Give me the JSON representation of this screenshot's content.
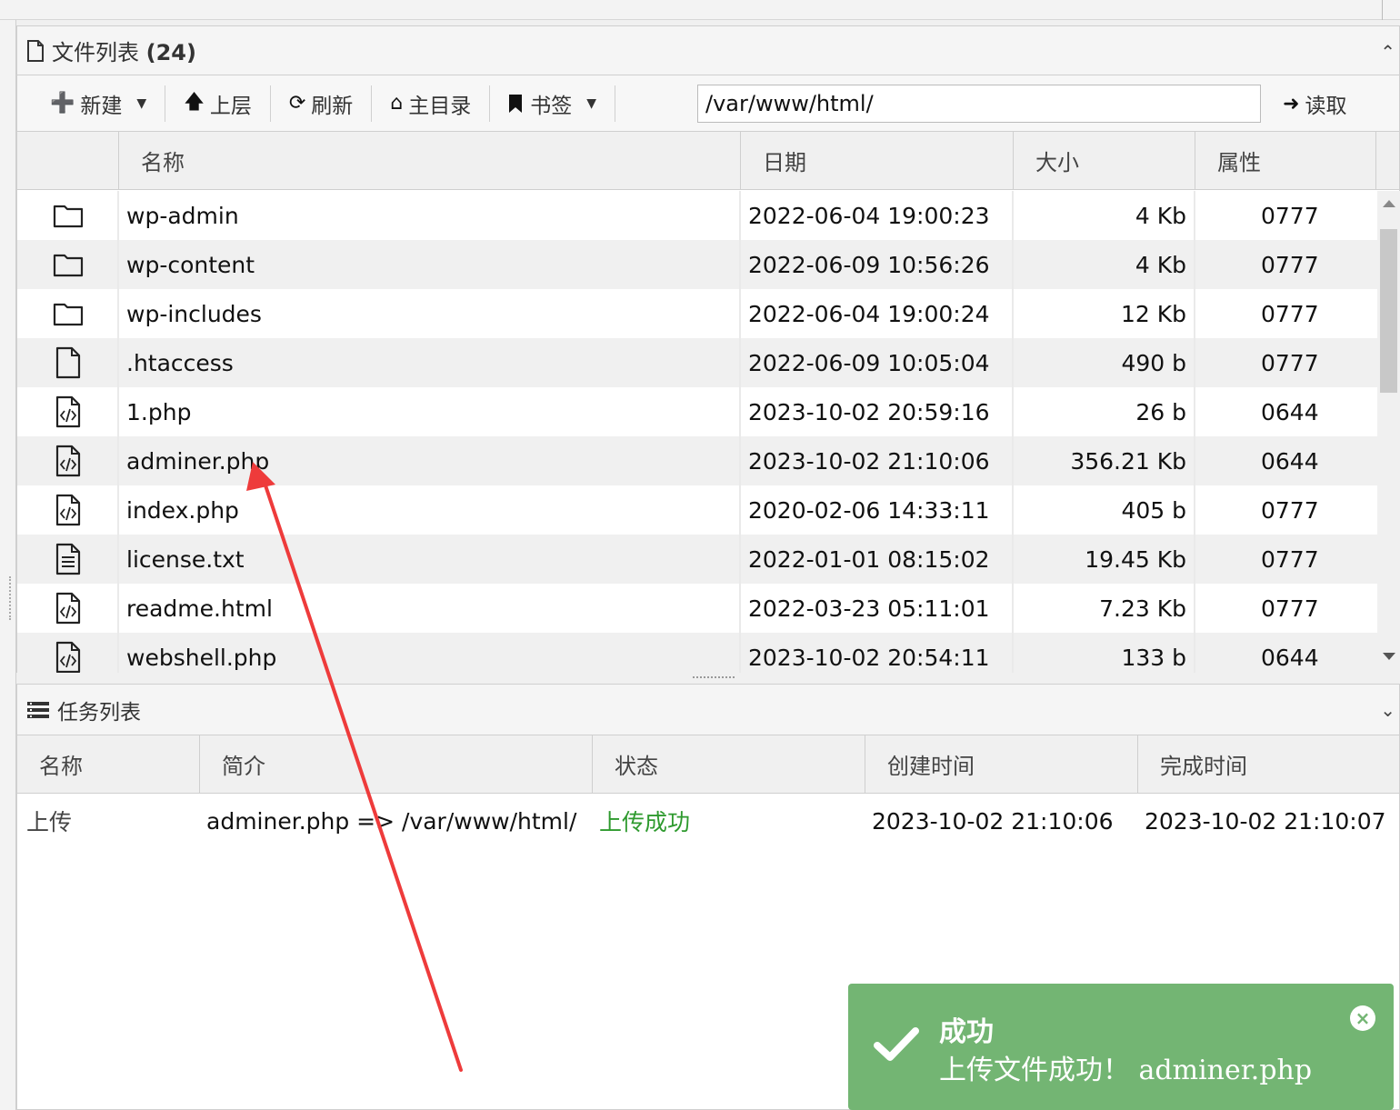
{
  "files_panel": {
    "title": "文件列表",
    "count": "(24)"
  },
  "toolbar": {
    "new_label": "新建",
    "up_label": "上层",
    "refresh_label": "刷新",
    "home_label": "主目录",
    "bookmark_label": "书签",
    "path_value": "/var/www/html/",
    "read_label": "读取"
  },
  "file_columns": [
    "名称",
    "日期",
    "大小",
    "属性"
  ],
  "files": [
    {
      "icon": "folder-icon",
      "name": "wp-admin",
      "date": "2022-06-04 19:00:23",
      "size": "4 Kb",
      "perm": "0777"
    },
    {
      "icon": "folder-icon",
      "name": "wp-content",
      "date": "2022-06-09 10:56:26",
      "size": "4 Kb",
      "perm": "0777"
    },
    {
      "icon": "folder-icon",
      "name": "wp-includes",
      "date": "2022-06-04 19:00:24",
      "size": "12 Kb",
      "perm": "0777"
    },
    {
      "icon": "file-icon",
      "name": ".htaccess",
      "date": "2022-06-09 10:05:04",
      "size": "490 b",
      "perm": "0777"
    },
    {
      "icon": "code-file-icon",
      "name": "1.php",
      "date": "2023-10-02 20:59:16",
      "size": "26 b",
      "perm": "0644"
    },
    {
      "icon": "code-file-icon",
      "name": "adminer.php",
      "date": "2023-10-02 21:10:06",
      "size": "356.21 Kb",
      "perm": "0644"
    },
    {
      "icon": "code-file-icon",
      "name": "index.php",
      "date": "2020-02-06 14:33:11",
      "size": "405 b",
      "perm": "0777"
    },
    {
      "icon": "text-file-icon",
      "name": "license.txt",
      "date": "2022-01-01 08:15:02",
      "size": "19.45 Kb",
      "perm": "0777"
    },
    {
      "icon": "code-file-icon",
      "name": "readme.html",
      "date": "2022-03-23 05:11:01",
      "size": "7.23 Kb",
      "perm": "0777"
    },
    {
      "icon": "code-file-icon",
      "name": "webshell.php",
      "date": "2023-10-02 20:54:11",
      "size": "133 b",
      "perm": "0644"
    }
  ],
  "tasks_panel": {
    "title": "任务列表"
  },
  "task_columns": [
    "名称",
    "简介",
    "状态",
    "创建时间",
    "完成时间"
  ],
  "tasks": [
    {
      "name": "上传",
      "desc": "adminer.php => /var/www/html/",
      "status": "上传成功",
      "created": "2023-10-02 21:10:06",
      "finished": "2023-10-02 21:10:07"
    }
  ],
  "toast": {
    "title": "成功",
    "message": "上传文件成功！ adminer.php"
  },
  "colors": {
    "success_green": "#73b573",
    "status_green": "#2e9a2e",
    "annotation_red": "#ee3b3b"
  }
}
